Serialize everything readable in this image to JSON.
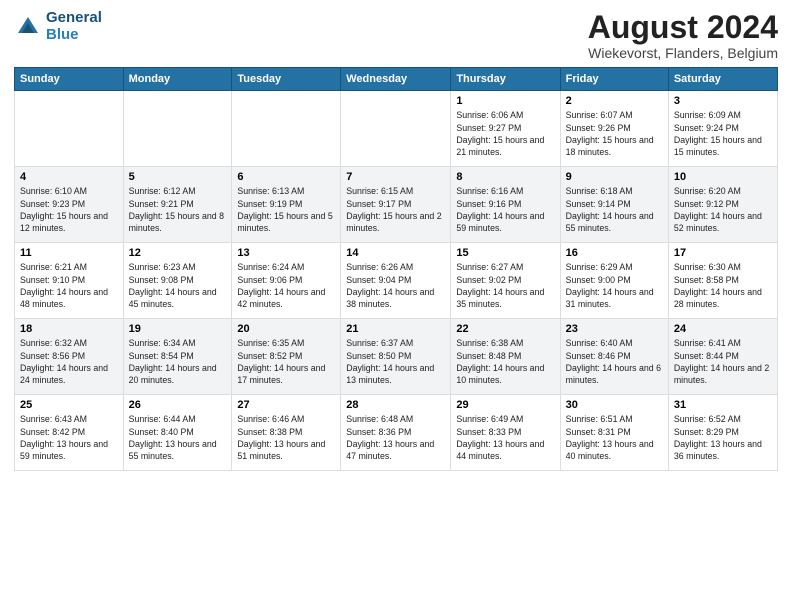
{
  "header": {
    "logo_line1": "General",
    "logo_line2": "Blue",
    "title": "August 2024",
    "subtitle": "Wiekevorst, Flanders, Belgium"
  },
  "weekdays": [
    "Sunday",
    "Monday",
    "Tuesday",
    "Wednesday",
    "Thursday",
    "Friday",
    "Saturday"
  ],
  "weeks": [
    [
      {
        "day": "",
        "info": ""
      },
      {
        "day": "",
        "info": ""
      },
      {
        "day": "",
        "info": ""
      },
      {
        "day": "",
        "info": ""
      },
      {
        "day": "1",
        "info": "Sunrise: 6:06 AM\nSunset: 9:27 PM\nDaylight: 15 hours\nand 21 minutes."
      },
      {
        "day": "2",
        "info": "Sunrise: 6:07 AM\nSunset: 9:26 PM\nDaylight: 15 hours\nand 18 minutes."
      },
      {
        "day": "3",
        "info": "Sunrise: 6:09 AM\nSunset: 9:24 PM\nDaylight: 15 hours\nand 15 minutes."
      }
    ],
    [
      {
        "day": "4",
        "info": "Sunrise: 6:10 AM\nSunset: 9:23 PM\nDaylight: 15 hours\nand 12 minutes."
      },
      {
        "day": "5",
        "info": "Sunrise: 6:12 AM\nSunset: 9:21 PM\nDaylight: 15 hours\nand 8 minutes."
      },
      {
        "day": "6",
        "info": "Sunrise: 6:13 AM\nSunset: 9:19 PM\nDaylight: 15 hours\nand 5 minutes."
      },
      {
        "day": "7",
        "info": "Sunrise: 6:15 AM\nSunset: 9:17 PM\nDaylight: 15 hours\nand 2 minutes."
      },
      {
        "day": "8",
        "info": "Sunrise: 6:16 AM\nSunset: 9:16 PM\nDaylight: 14 hours\nand 59 minutes."
      },
      {
        "day": "9",
        "info": "Sunrise: 6:18 AM\nSunset: 9:14 PM\nDaylight: 14 hours\nand 55 minutes."
      },
      {
        "day": "10",
        "info": "Sunrise: 6:20 AM\nSunset: 9:12 PM\nDaylight: 14 hours\nand 52 minutes."
      }
    ],
    [
      {
        "day": "11",
        "info": "Sunrise: 6:21 AM\nSunset: 9:10 PM\nDaylight: 14 hours\nand 48 minutes."
      },
      {
        "day": "12",
        "info": "Sunrise: 6:23 AM\nSunset: 9:08 PM\nDaylight: 14 hours\nand 45 minutes."
      },
      {
        "day": "13",
        "info": "Sunrise: 6:24 AM\nSunset: 9:06 PM\nDaylight: 14 hours\nand 42 minutes."
      },
      {
        "day": "14",
        "info": "Sunrise: 6:26 AM\nSunset: 9:04 PM\nDaylight: 14 hours\nand 38 minutes."
      },
      {
        "day": "15",
        "info": "Sunrise: 6:27 AM\nSunset: 9:02 PM\nDaylight: 14 hours\nand 35 minutes."
      },
      {
        "day": "16",
        "info": "Sunrise: 6:29 AM\nSunset: 9:00 PM\nDaylight: 14 hours\nand 31 minutes."
      },
      {
        "day": "17",
        "info": "Sunrise: 6:30 AM\nSunset: 8:58 PM\nDaylight: 14 hours\nand 28 minutes."
      }
    ],
    [
      {
        "day": "18",
        "info": "Sunrise: 6:32 AM\nSunset: 8:56 PM\nDaylight: 14 hours\nand 24 minutes."
      },
      {
        "day": "19",
        "info": "Sunrise: 6:34 AM\nSunset: 8:54 PM\nDaylight: 14 hours\nand 20 minutes."
      },
      {
        "day": "20",
        "info": "Sunrise: 6:35 AM\nSunset: 8:52 PM\nDaylight: 14 hours\nand 17 minutes."
      },
      {
        "day": "21",
        "info": "Sunrise: 6:37 AM\nSunset: 8:50 PM\nDaylight: 14 hours\nand 13 minutes."
      },
      {
        "day": "22",
        "info": "Sunrise: 6:38 AM\nSunset: 8:48 PM\nDaylight: 14 hours\nand 10 minutes."
      },
      {
        "day": "23",
        "info": "Sunrise: 6:40 AM\nSunset: 8:46 PM\nDaylight: 14 hours\nand 6 minutes."
      },
      {
        "day": "24",
        "info": "Sunrise: 6:41 AM\nSunset: 8:44 PM\nDaylight: 14 hours\nand 2 minutes."
      }
    ],
    [
      {
        "day": "25",
        "info": "Sunrise: 6:43 AM\nSunset: 8:42 PM\nDaylight: 13 hours\nand 59 minutes."
      },
      {
        "day": "26",
        "info": "Sunrise: 6:44 AM\nSunset: 8:40 PM\nDaylight: 13 hours\nand 55 minutes."
      },
      {
        "day": "27",
        "info": "Sunrise: 6:46 AM\nSunset: 8:38 PM\nDaylight: 13 hours\nand 51 minutes."
      },
      {
        "day": "28",
        "info": "Sunrise: 6:48 AM\nSunset: 8:36 PM\nDaylight: 13 hours\nand 47 minutes."
      },
      {
        "day": "29",
        "info": "Sunrise: 6:49 AM\nSunset: 8:33 PM\nDaylight: 13 hours\nand 44 minutes."
      },
      {
        "day": "30",
        "info": "Sunrise: 6:51 AM\nSunset: 8:31 PM\nDaylight: 13 hours\nand 40 minutes."
      },
      {
        "day": "31",
        "info": "Sunrise: 6:52 AM\nSunset: 8:29 PM\nDaylight: 13 hours\nand 36 minutes."
      }
    ]
  ]
}
